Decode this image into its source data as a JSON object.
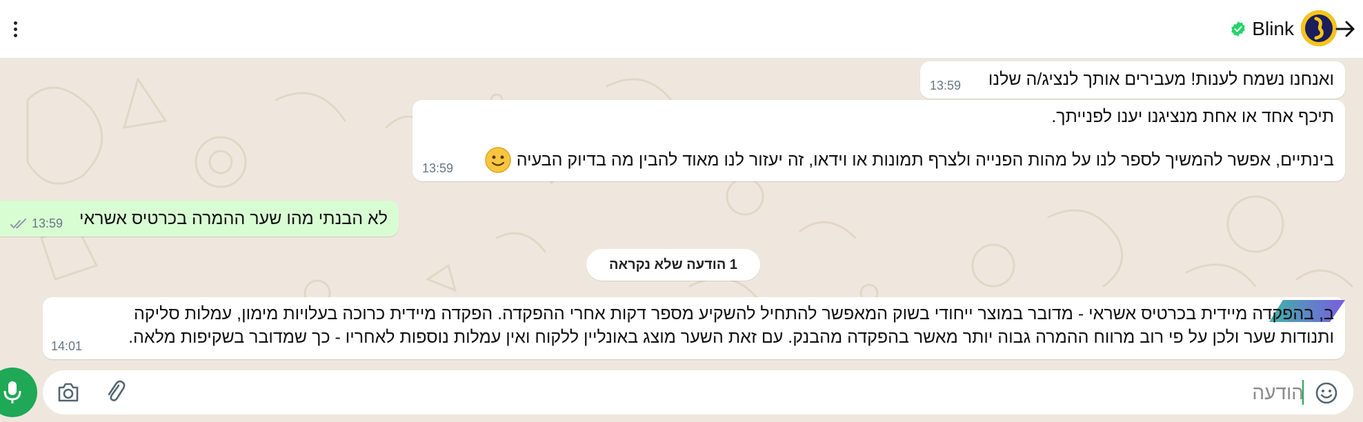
{
  "header": {
    "contact_name": "Blink",
    "menu_icon": "more-vert-icon",
    "back_icon": "arrow-right-icon",
    "verified_icon": "verified-badge-icon",
    "verified_color": "#25d366"
  },
  "messages": [
    {
      "text": "ואנחנו נשמח לענות! מעבירים אותך לנציג/ה שלנו",
      "time": "13:59",
      "direction": "in"
    },
    {
      "lines": [
        "תיכף אחד או אחת מנציגנו יענו לפנייתך.",
        "בינתיים, אפשר להמשיך לספר לנו על מהות הפנייה ולצרף תמונות או וידאו, זה יעזור לנו מאוד להבין מה בדיוק הבעיה"
      ],
      "emoji": "slightly-smiling-face-emoji",
      "time": "13:59",
      "direction": "in"
    },
    {
      "text": "לא הבנתי מהו שער ההמרה בכרטיס אשראי",
      "time": "13:59",
      "direction": "out",
      "status_icon": "double-check-icon"
    },
    {
      "lines": [
        "ב, בהפקדה מיידית בכרטיס אשראי - מדובר במוצר ייחודי בשוק המאפשר להתחיל להשקיע מספר דקות אחרי ההפקדה. הפקדה מיידית כרוכה בעלויות מימון, עמלות סליקה",
        "ותנודות שער ולכן על פי רוב מרווח ההמרה גבוה יותר מאשר בהפקדה מהבנק. עם זאת השער מוצג באונליין ללקוח ואין עמלות נוספות לאחריו - כך שמדובר בשקיפות מלאה."
      ],
      "time": "14:01",
      "direction": "in"
    }
  ],
  "unread_banner": "1 הודעה שלא נקראה",
  "input": {
    "placeholder": "הודעה",
    "value": "",
    "emoji_icon": "emoji-icon",
    "attach_icon": "paperclip-icon",
    "camera_icon": "camera-icon",
    "mic_icon": "microphone-icon"
  },
  "colors": {
    "chat_background": "#efe7dd",
    "outgoing_bubble": "#d9fdd3",
    "incoming_bubble": "#ffffff",
    "accent": "#1fa855",
    "avatar_bg": "#1b1d5c",
    "avatar_accent": "#f5c518"
  }
}
